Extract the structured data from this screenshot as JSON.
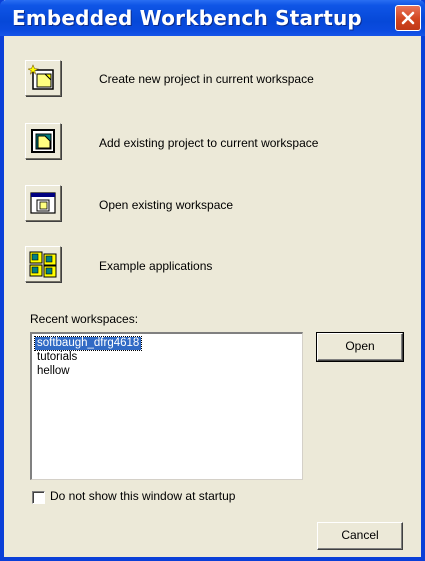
{
  "window": {
    "title": "Embedded Workbench Startup"
  },
  "actions": [
    {
      "label": "Create new project in current workspace",
      "icon": "new-project-icon"
    },
    {
      "label": "Add existing project to current workspace",
      "icon": "add-project-icon"
    },
    {
      "label": "Open existing workspace",
      "icon": "open-workspace-icon"
    },
    {
      "label": "Example applications",
      "icon": "example-applications-icon"
    }
  ],
  "recent": {
    "label": "Recent workspaces:",
    "items": [
      "softbaugh_dfrg4618",
      "tutorials",
      "hellow"
    ],
    "selected": "softbaugh_dfrg4618"
  },
  "buttons": {
    "open": "Open",
    "cancel": "Cancel"
  },
  "startup_option": {
    "label": "Do not show this window at startup",
    "checked": false
  },
  "colors": {
    "titlebar": "#0648d8",
    "selection": "#316ac5",
    "close": "#d2451f",
    "face": "#ece9d8"
  }
}
